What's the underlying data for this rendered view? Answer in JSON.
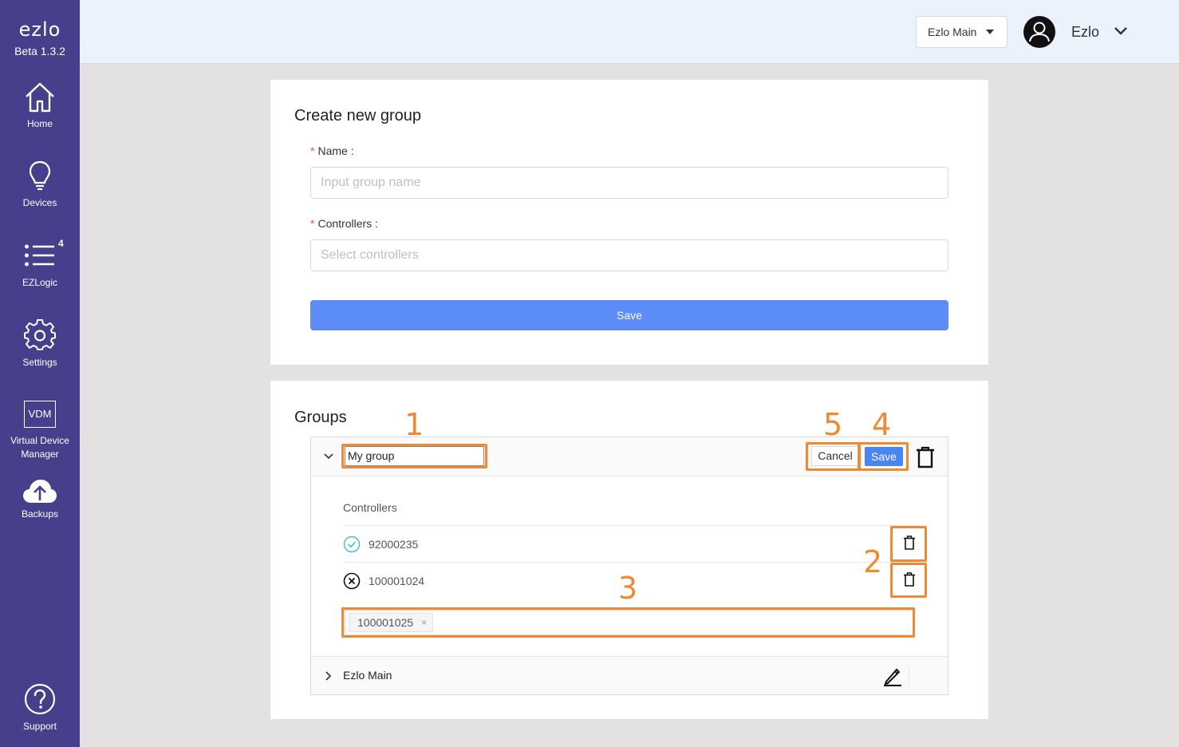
{
  "sidebar": {
    "logo": "ezlo",
    "version": "Beta 1.3.2",
    "items": [
      {
        "label": "Home",
        "icon": "home-icon"
      },
      {
        "label": "Devices",
        "icon": "lightbulb-icon"
      },
      {
        "label": "EZLogic",
        "icon": "list-icon",
        "badge": "4"
      },
      {
        "label": "Settings",
        "icon": "gear-icon"
      },
      {
        "label": "Virtual Device Manager",
        "icon": "vdm-icon",
        "icon_text": "VDM"
      },
      {
        "label": "Backups",
        "icon": "cloud-upload-icon"
      },
      {
        "label": "Support",
        "icon": "help-icon"
      }
    ]
  },
  "header": {
    "controller_select": "Ezlo Main",
    "user_name": "Ezlo"
  },
  "create_group": {
    "title": "Create new group",
    "required_mark": "*",
    "name_label": "Name",
    "name_placeholder": "Input group name",
    "controllers_label": "Controllers",
    "controllers_placeholder": "Select controllers",
    "save_label": "Save"
  },
  "groups": {
    "title": "Groups",
    "editing_group": {
      "name_value": "My group",
      "cancel_label": "Cancel",
      "save_label": "Save",
      "controllers_label": "Controllers",
      "controllers": [
        {
          "id": "92000235",
          "status": "online"
        },
        {
          "id": "100001024",
          "status": "offline"
        }
      ],
      "new_controller_tag": "100001025",
      "tag_remove": "×"
    },
    "other_group": {
      "name": "Ezlo Main"
    }
  },
  "annotations": {
    "color": "#ef8a34",
    "labels": [
      "1",
      "2",
      "3",
      "4",
      "5"
    ]
  },
  "colors": {
    "sidebar": "#453f8c",
    "header": "#eaf2fb",
    "primary": "#5b8cf8"
  }
}
